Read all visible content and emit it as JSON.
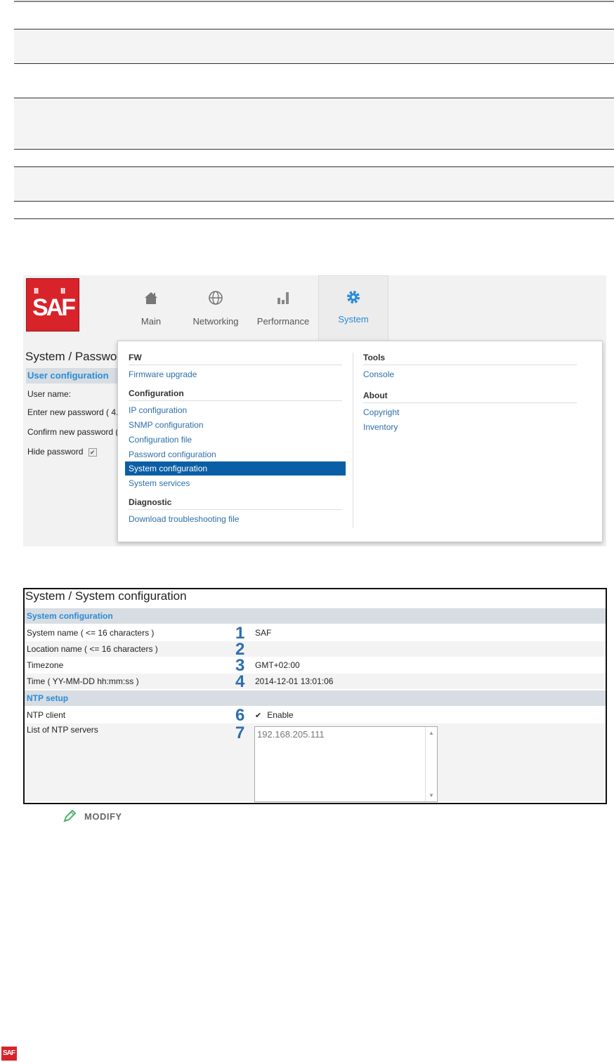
{
  "nav": {
    "items": [
      {
        "label": "Main",
        "icon": "home-icon"
      },
      {
        "label": "Networking",
        "icon": "globe-icon"
      },
      {
        "label": "Performance",
        "icon": "bar-chart-icon"
      },
      {
        "label": "System",
        "icon": "gear-icon"
      }
    ],
    "active": "System"
  },
  "logo": {
    "text": "SAF"
  },
  "password_page": {
    "title": "System / Passwo",
    "section": "User configuration",
    "labels": [
      "User name:",
      "Enter new password ( 4.",
      "Confirm new password (",
      "Hide password"
    ],
    "hide_password_checked": true
  },
  "menu": {
    "left": {
      "fw_head": "FW",
      "fw_items": [
        "Firmware upgrade"
      ],
      "config_head": "Configuration",
      "config_items": [
        "IP configuration",
        "SNMP configuration",
        "Configuration file",
        "Password configuration",
        "System configuration",
        "System services"
      ],
      "selected": "System configuration",
      "diag_head": "Diagnostic",
      "diag_items": [
        "Download troubleshooting file"
      ]
    },
    "right": {
      "tools_head": "Tools",
      "tools_items": [
        "Console"
      ],
      "about_head": "About",
      "about_items": [
        "Copyright",
        "Inventory"
      ]
    }
  },
  "system_config": {
    "title": "System / System configuration",
    "section1": "System configuration",
    "rows": [
      {
        "label": "System name ( <= 16 characters )",
        "num": "1",
        "value": "SAF"
      },
      {
        "label": "Location name ( <= 16 characters )",
        "num": "2",
        "value": ""
      },
      {
        "label": "Timezone",
        "num": "3",
        "value": "GMT+02:00"
      },
      {
        "label": "Time ( YY-MM-DD hh:mm:ss )",
        "num": "4",
        "value": "2014-12-01 13:01:06"
      }
    ],
    "section2": "NTP setup",
    "ntp_client": {
      "label": "NTP client",
      "num": "6",
      "value": "Enable",
      "checked": true
    },
    "ntp_servers": {
      "label": "List of NTP servers",
      "num": "7",
      "value": "192.168.205.111"
    }
  },
  "modify_label": "MODIFY",
  "colors": {
    "brand_red": "#d8232a",
    "link_blue": "#2d6fa8",
    "selected_blue": "#0a5ea6",
    "marker_blue": "#2f6db0"
  }
}
